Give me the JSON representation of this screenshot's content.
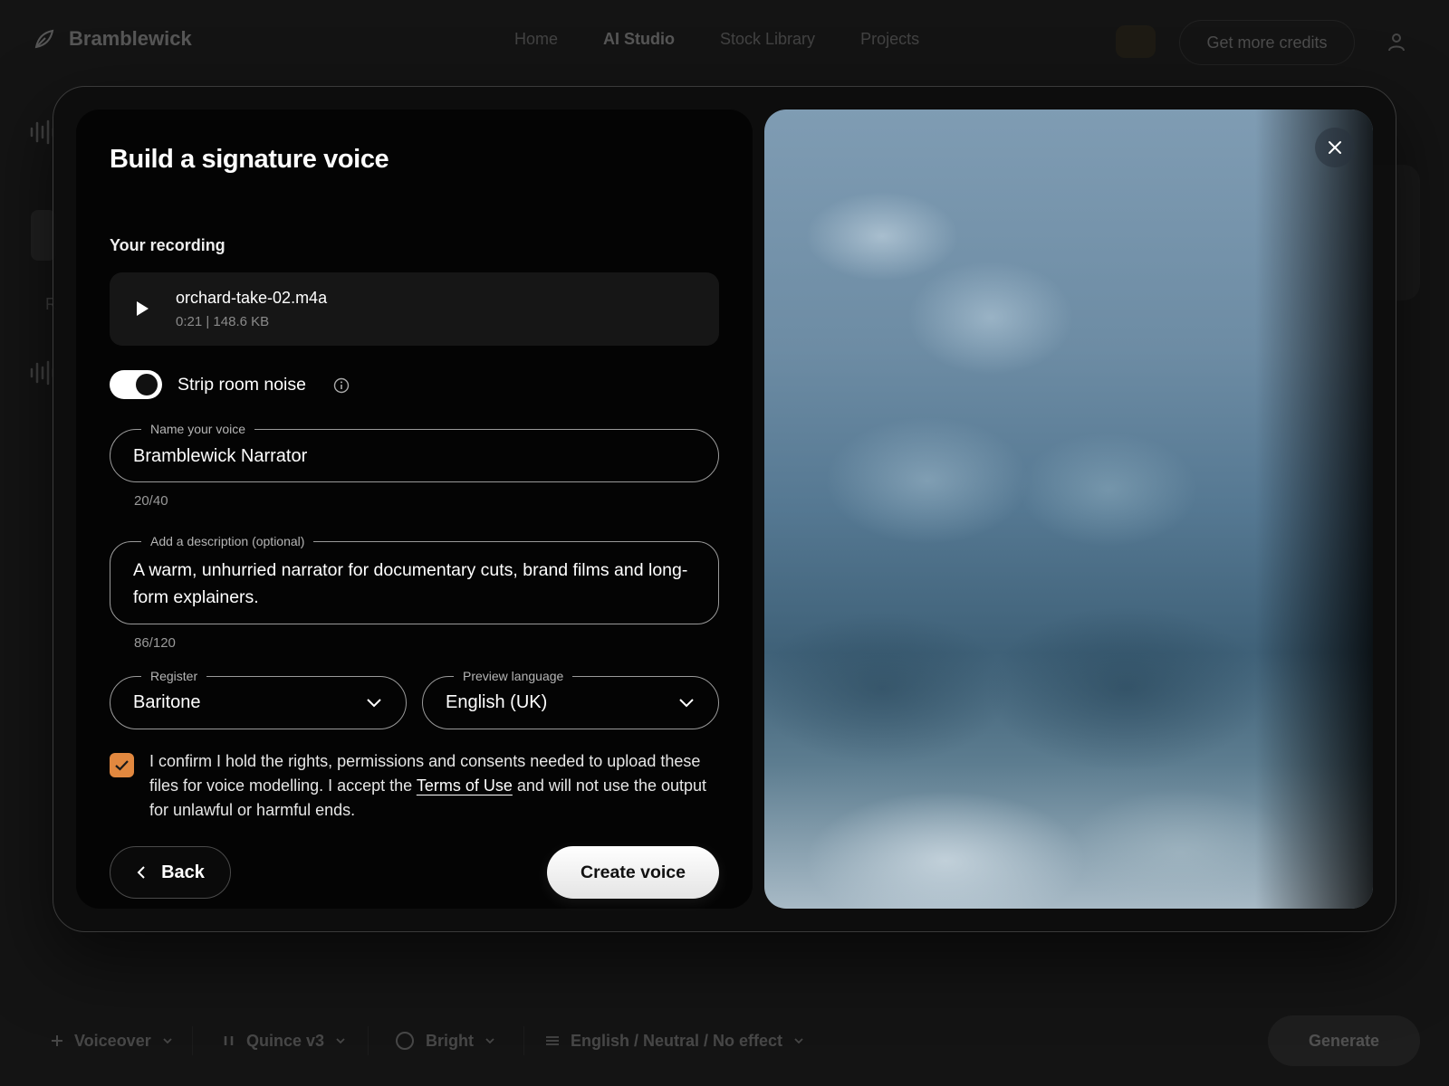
{
  "app": {
    "brand": "Bramblewick",
    "nav": [
      "Home",
      "AI Studio",
      "Stock Library",
      "Projects"
    ],
    "credits_label": "Get more credits"
  },
  "bottom_bar": {
    "items": [
      "Voiceover",
      "Quince v3",
      "Bright",
      "English / Neutral / No effect"
    ],
    "generate_label": "Generate"
  },
  "modal": {
    "title": "Build a signature voice",
    "recording_label": "Your recording",
    "recording": {
      "file_name": "orchard-take-02.m4a",
      "meta": "0:21 | 148.6 KB"
    },
    "noise_toggle": {
      "label": "Strip room noise",
      "enabled": true
    },
    "name_field": {
      "legend": "Name your voice",
      "value": "Bramblewick Narrator",
      "counter": "20/40"
    },
    "description_field": {
      "legend": "Add a description (optional)",
      "value": "A warm, unhurried narrator for documentary cuts, brand films and long-form explainers.",
      "counter": "86/120"
    },
    "register_select": {
      "legend": "Register",
      "value": "Baritone"
    },
    "language_select": {
      "legend": "Preview language",
      "value": "English (UK)"
    },
    "consent": {
      "checked": true,
      "text_before": "I confirm I hold the rights, permissions and consents needed to upload these files for voice modelling. I accept the ",
      "link": "Terms of Use",
      "text_after": " and will not use the output for unlawful or harmful ends."
    },
    "back_label": "Back",
    "create_label": "Create voice"
  },
  "colors": {
    "accent_checkbox": "#e2883f",
    "panel_background": "#040404",
    "overlay_background": "#141414"
  }
}
